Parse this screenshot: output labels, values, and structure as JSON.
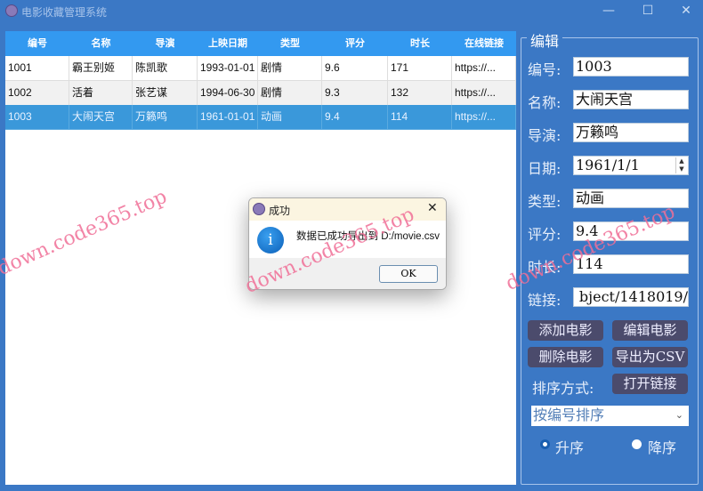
{
  "window": {
    "title": "电影收藏管理系统",
    "minimize": "—",
    "maximize": "☐",
    "close": "✕"
  },
  "table": {
    "headers": [
      "编号",
      "名称",
      "导演",
      "上映日期",
      "类型",
      "评分",
      "时长",
      "在线链接"
    ],
    "rows": [
      [
        "1001",
        "霸王别姬",
        "陈凯歌",
        "1993-01-01",
        "剧情",
        "9.6",
        "171",
        "https://..."
      ],
      [
        "1002",
        "活着",
        "张艺谋",
        "1994-06-30",
        "剧情",
        "9.3",
        "132",
        "https://..."
      ],
      [
        "1003",
        "大闹天宫",
        "万籁鸣",
        "1961-01-01",
        "动画",
        "9.4",
        "114",
        "https://..."
      ]
    ],
    "selected_row": 2
  },
  "editor": {
    "title": "编辑",
    "fields": [
      {
        "label": "编号:",
        "value": "1003"
      },
      {
        "label": "名称:",
        "value": "大闹天宫"
      },
      {
        "label": "导演:",
        "value": "万籁鸣"
      },
      {
        "label": "日期:",
        "value": "1961/1/1"
      },
      {
        "label": "类型:",
        "value": "动画"
      },
      {
        "label": "评分:",
        "value": "9.4"
      },
      {
        "label": "时长:",
        "value": "114"
      },
      {
        "label": "链接:",
        "value": "bject/1418019/"
      }
    ],
    "buttons": {
      "add": "添加电影",
      "edit": "编辑电影",
      "delete": "删除电影",
      "export": "导出为CSV",
      "open_link": "打开链接"
    },
    "sort_label": "排序方式:",
    "sort_option": "按编号排序",
    "ascending": "升序",
    "descending": "降序",
    "ascending_selected": true
  },
  "dialog": {
    "title": "成功",
    "message": "数据已成功导出到 D:/movie.csv",
    "ok": "OK",
    "close": "✕",
    "icon": "info-icon"
  },
  "watermark": "down.code365.top",
  "colors": {
    "background": "#3b78c5",
    "header": "#3399f0",
    "selected": "#3a98da",
    "button": "#4b4b6c"
  }
}
